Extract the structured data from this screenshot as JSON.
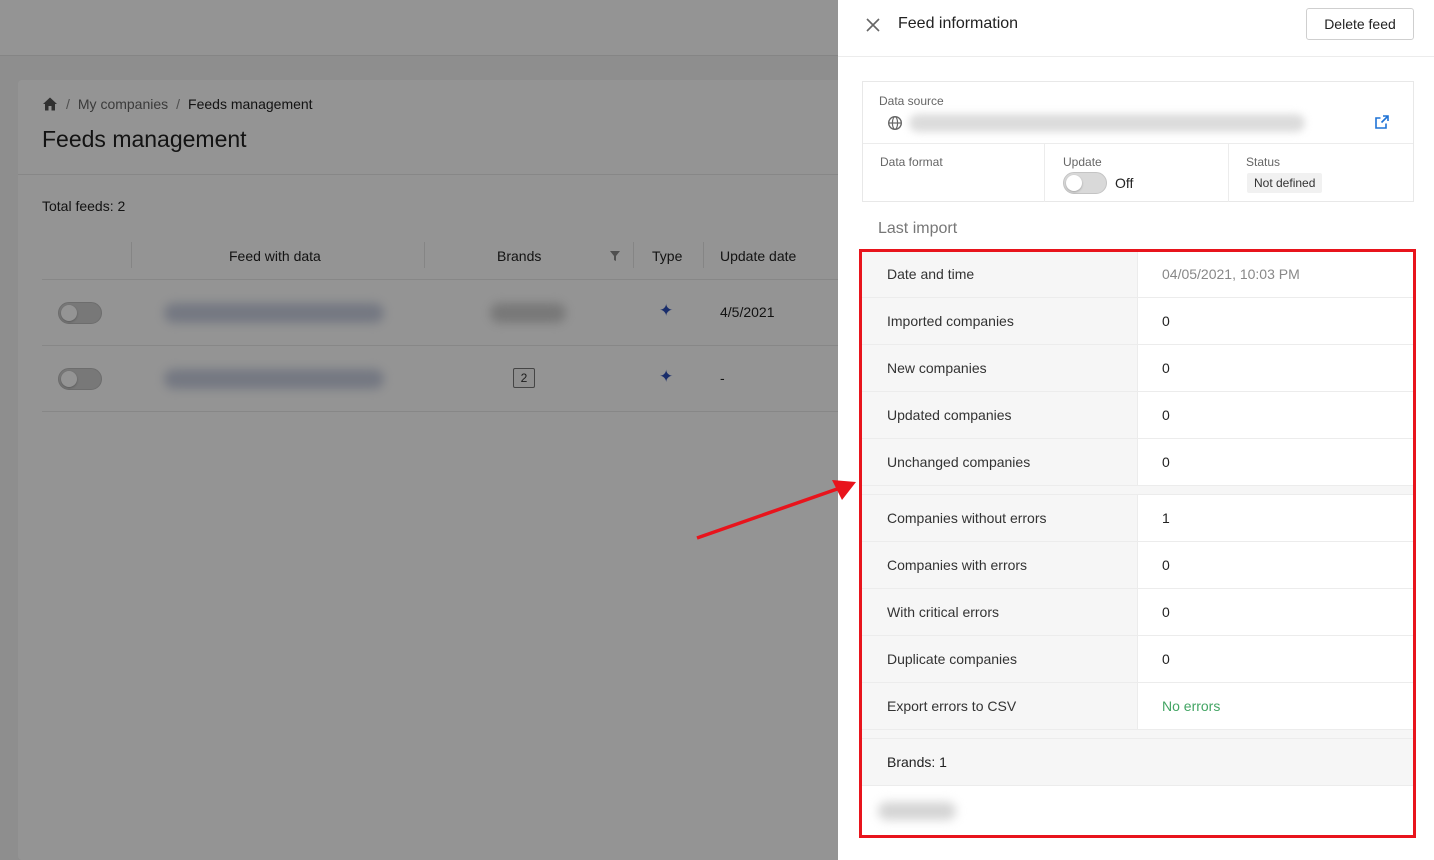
{
  "breadcrumb": {
    "items": [
      "My companies",
      "Feeds management"
    ]
  },
  "page": {
    "title": "Feeds management",
    "total": "Total feeds: 2"
  },
  "table": {
    "columns": [
      "Feed with data",
      "Brands",
      "Type",
      "Update date"
    ],
    "rows": [
      {
        "brands": "",
        "update_date": "4/5/2021"
      },
      {
        "brands": "2",
        "update_date": "-"
      }
    ]
  },
  "drawer": {
    "title": "Feed information",
    "delete_label": "Delete feed",
    "data_source_label": "Data source",
    "data_format_label": "Data format",
    "update_label": "Update",
    "update_state": "Off",
    "status_label": "Status",
    "status_value": "Not defined",
    "last_import_title": "Last import",
    "stats": [
      {
        "label": "Date and time",
        "value": "04/05/2021, 10:03 PM"
      },
      {
        "label": "Imported companies",
        "value": "0"
      },
      {
        "label": "New companies",
        "value": "0"
      },
      {
        "label": "Updated companies",
        "value": "0"
      },
      {
        "label": "Unchanged companies",
        "value": "0"
      },
      {
        "label": "Companies without errors",
        "value": "1"
      },
      {
        "label": "Companies with errors",
        "value": "0"
      },
      {
        "label": "With critical errors",
        "value": "0"
      },
      {
        "label": "Duplicate companies",
        "value": "0"
      },
      {
        "label": "Export errors to CSV",
        "value": "No errors"
      }
    ],
    "brands_label": "Brands: 1"
  },
  "colors": {
    "accent": "#1f73d6",
    "success": "#43a564",
    "highlight": "#e8141c",
    "type_icon": "#2c4fb8"
  },
  "icons": [
    "home-icon",
    "filter-icon",
    "close-icon",
    "globe-icon",
    "external-link-icon",
    "sparkle-icon"
  ]
}
